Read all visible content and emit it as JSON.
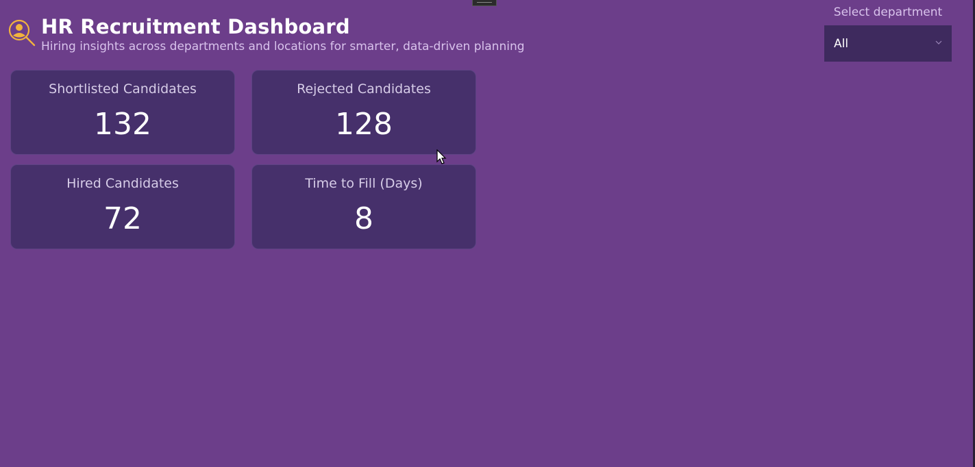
{
  "header": {
    "title": "HR Recruitment Dashboard",
    "subtitle": "Hiring insights across departments and locations for smarter, data-driven planning",
    "logo_icon": "user-search-icon",
    "logo_color": "#f2b33d"
  },
  "filter": {
    "label": "Select department",
    "selected": "All",
    "icon": "chevron-down-icon"
  },
  "kpis": [
    {
      "label": "Shortlisted Candidates",
      "value": "132"
    },
    {
      "label": "Rejected Candidates",
      "value": "128"
    },
    {
      "label": "Hired Candidates",
      "value": "72"
    },
    {
      "label": "Time to Fill (Days)",
      "value": "8"
    }
  ],
  "colors": {
    "background": "#6c3e8a",
    "card": "#46306b",
    "dropdown": "#3e2a5e",
    "accent": "#f2b33d"
  }
}
